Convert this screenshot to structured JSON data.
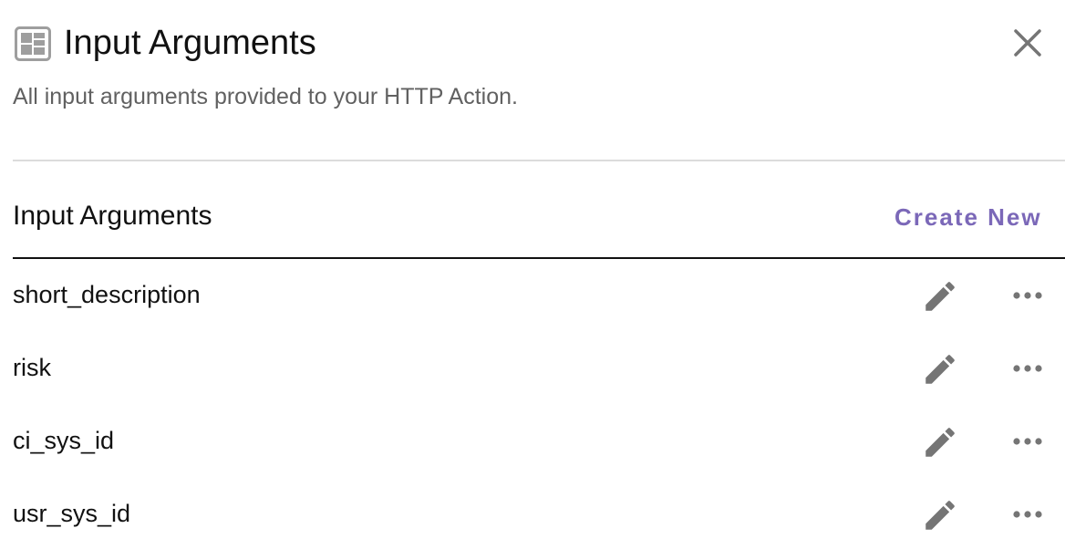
{
  "panel": {
    "title": "Input Arguments",
    "subtitle": "All input arguments provided to your HTTP Action.",
    "header_icon": "input-panel-icon",
    "close_icon": "close-icon"
  },
  "section": {
    "header": "Input Arguments",
    "create_new_label": "Create New"
  },
  "arguments": [
    {
      "name": "short_description",
      "edit_icon": "pencil-icon",
      "more_icon": "more-horizontal-icon"
    },
    {
      "name": "risk",
      "edit_icon": "pencil-icon",
      "more_icon": "more-horizontal-icon"
    },
    {
      "name": "ci_sys_id",
      "edit_icon": "pencil-icon",
      "more_icon": "more-horizontal-icon"
    },
    {
      "name": "usr_sys_id",
      "edit_icon": "pencil-icon",
      "more_icon": "more-horizontal-icon"
    }
  ],
  "colors": {
    "accent": "#7b68b8",
    "icon_gray": "#757575",
    "subtitle_gray": "#616161",
    "divider": "#dcdcdc"
  }
}
